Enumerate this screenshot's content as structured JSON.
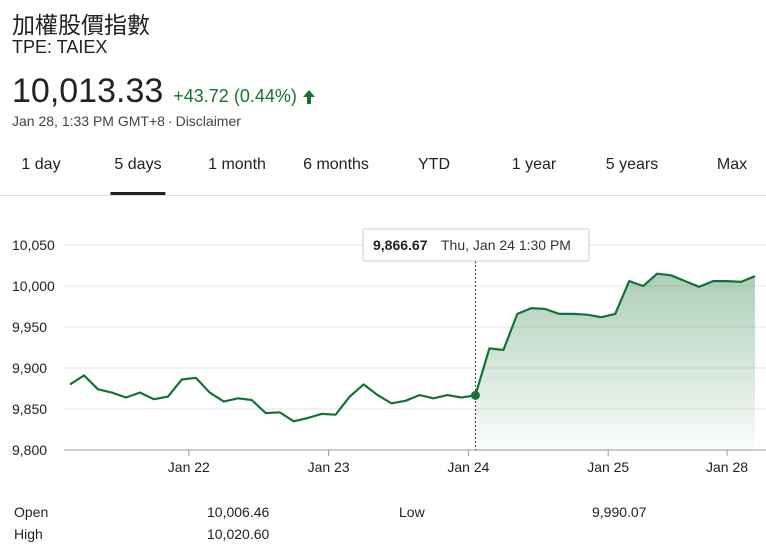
{
  "header": {
    "title": "加權股價指數",
    "ticker": "TPE: TAIEX",
    "price": "10,013.33",
    "change": "+43.72 (0.44%)",
    "timestamp": "Jan 28, 1:33 PM GMT+8",
    "separator": "·",
    "disclaimer": "Disclaimer",
    "accent_color": "#137333"
  },
  "tabs": [
    {
      "label": "1 day",
      "active": false
    },
    {
      "label": "5 days",
      "active": true
    },
    {
      "label": "1 month",
      "active": false
    },
    {
      "label": "6 months",
      "active": false
    },
    {
      "label": "YTD",
      "active": false
    },
    {
      "label": "1 year",
      "active": false
    },
    {
      "label": "5 years",
      "active": false
    },
    {
      "label": "Max",
      "active": false
    }
  ],
  "tooltip": {
    "value": "9,866.67",
    "label": "Thu, Jan 24 1:30 PM"
  },
  "stats": {
    "open_label": "Open",
    "open_value": "10,006.46",
    "high_label": "High",
    "high_value": "10,020.60",
    "low_label": "Low",
    "low_value": "9,990.07"
  },
  "chart_data": {
    "type": "line",
    "ylim": [
      9800,
      10060
    ],
    "yticks": [
      9800,
      9850,
      9900,
      9950,
      10000,
      10050
    ],
    "ytick_labels": [
      "9,800",
      "9,850",
      "9,900",
      "9,950",
      "10,000",
      "10,050"
    ],
    "xtick_labels": [
      "Jan 22",
      "Jan 23",
      "Jan 24",
      "Jan 25",
      "Jan 28"
    ],
    "grid": true,
    "line_color": "#137333",
    "highlight_index": 29,
    "series": [
      {
        "values": [
          9880,
          9891,
          9874,
          9870,
          9864,
          9870,
          9862,
          9865,
          9886,
          9888,
          9870,
          9859,
          9863,
          9861,
          9845,
          9846,
          9835,
          9839,
          9844,
          9843,
          9865,
          9880,
          9867,
          9857,
          9860,
          9867,
          9863,
          9867,
          9864,
          9866.67,
          9924,
          9922,
          9966,
          9973,
          9972,
          9966,
          9966,
          9965,
          9962,
          9966,
          10006,
          10000,
          10015,
          10013,
          10006,
          9999,
          10006,
          10006,
          10005,
          10012
        ]
      }
    ]
  }
}
